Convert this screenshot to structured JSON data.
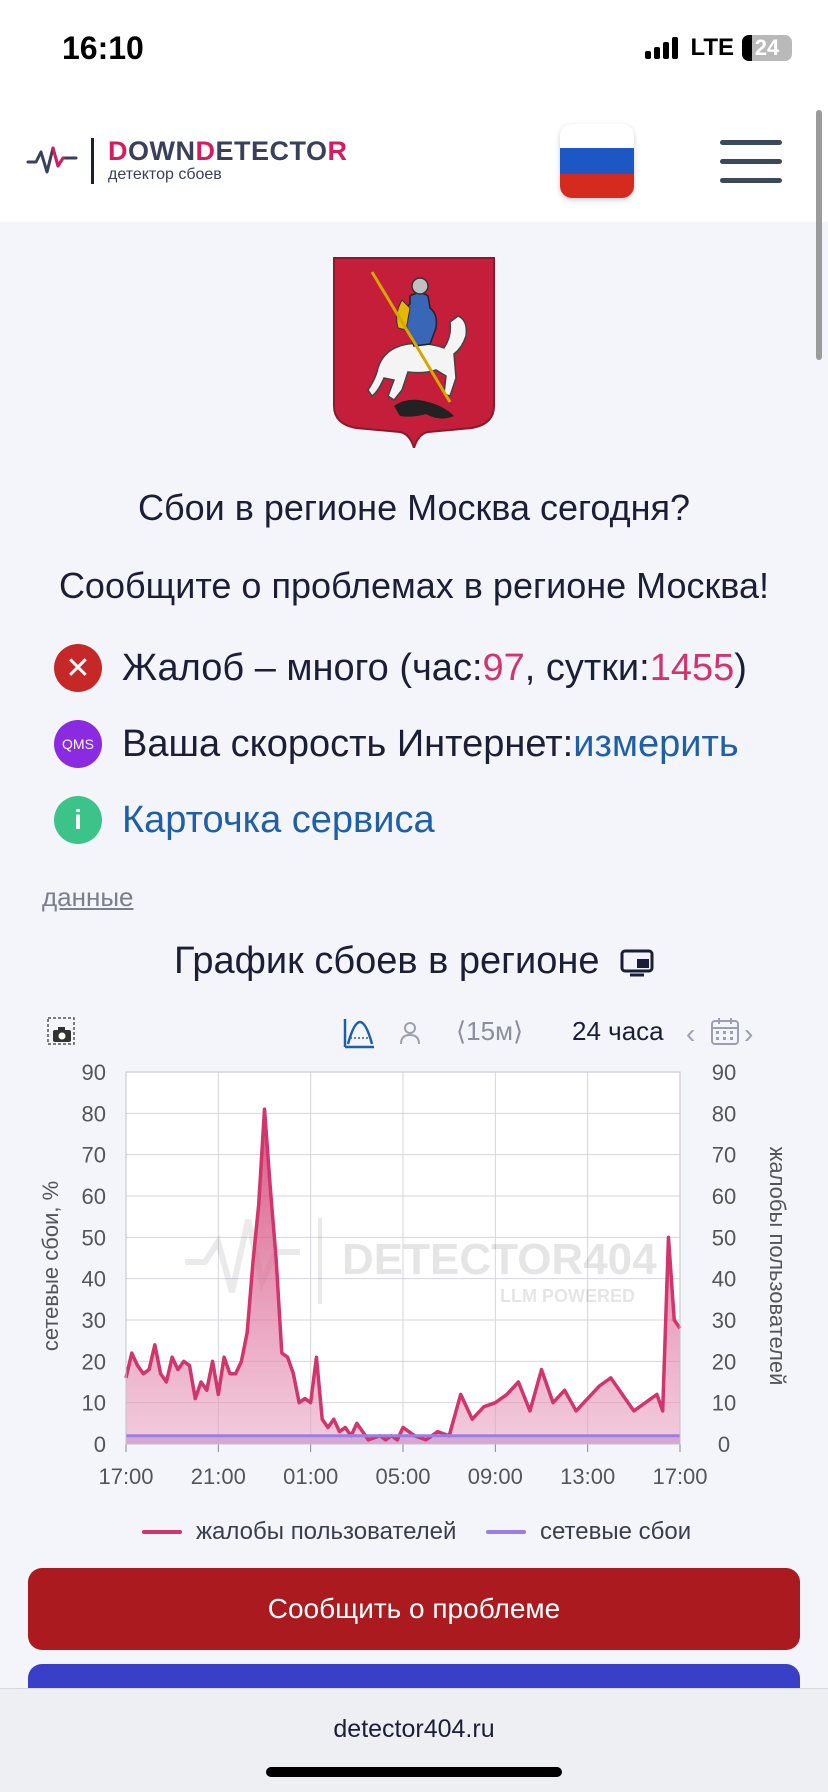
{
  "status": {
    "time": "16:10",
    "network": "LTE",
    "battery": "24"
  },
  "header": {
    "logo_title_parts": [
      "D",
      "OWN",
      "D",
      "ETECTO",
      "R"
    ],
    "logo_subtitle": "детектор сбоев"
  },
  "region": {
    "title": "Сбои в регионе Москва сегодня?",
    "subtitle": "Сообщите о проблемах в регионе Москва!"
  },
  "info": {
    "complaints_prefix": "Жалоб – много (час: ",
    "hour_count": "97",
    "mid": ", сутки: ",
    "day_count": "1455",
    "suffix": ")",
    "speed_label": "Ваша скорость Интернет: ",
    "speed_link": "измерить",
    "card_link": "Карточка сервиса",
    "qms_label": "QMS",
    "info_icon": "i",
    "error_icon": "✕"
  },
  "data_link": "данные",
  "chart_section": {
    "title": "График сбоев в регионе",
    "interval": "⟨15м⟩",
    "range": "24 часа",
    "prev": "‹",
    "next": "›"
  },
  "chart_data": {
    "type": "area",
    "y_left_label": "сетевые сбои, %",
    "y_right_label": "жалобы пользователей",
    "ylim": [
      0,
      90
    ],
    "y_ticks": [
      "0",
      "10",
      "20",
      "30",
      "40",
      "50",
      "60",
      "70",
      "80",
      "90"
    ],
    "x_ticks": [
      "17:00",
      "21:00",
      "01:00",
      "05:00",
      "09:00",
      "13:00",
      "17:00"
    ],
    "watermark": "DETECTOR404",
    "watermark_sub": "LLM POWERED",
    "x_hours": [
      0,
      0.25,
      0.5,
      0.75,
      1.0,
      1.25,
      1.5,
      1.75,
      2.0,
      2.25,
      2.5,
      2.75,
      3.0,
      3.25,
      3.5,
      3.75,
      4.0,
      4.25,
      4.5,
      4.75,
      5.0,
      5.25,
      5.5,
      5.75,
      6.0,
      6.25,
      6.5,
      6.75,
      7.0,
      7.25,
      7.5,
      7.75,
      8.0,
      8.25,
      8.5,
      8.75,
      9.0,
      9.25,
      9.5,
      9.75,
      10.0,
      10.5,
      11.0,
      11.25,
      11.5,
      11.75,
      12.0,
      12.5,
      13.0,
      13.5,
      14.0,
      14.5,
      15.0,
      15.5,
      16.0,
      16.5,
      17.0,
      17.5,
      18.0,
      18.5,
      19.0,
      19.5,
      20.0,
      20.5,
      21.0,
      21.5,
      22.0,
      22.5,
      23.0,
      23.25,
      23.5,
      23.75,
      24.0
    ],
    "series": [
      {
        "name": "жалобы пользователей",
        "color": "#d1356b",
        "values": [
          16,
          22,
          19,
          17,
          18,
          24,
          17,
          15,
          21,
          18,
          20,
          19,
          11,
          15,
          13,
          20,
          12,
          21,
          17,
          17,
          20,
          27,
          44,
          58,
          81,
          62,
          45,
          22,
          21,
          17,
          10,
          11,
          10,
          21,
          6,
          4,
          6,
          3,
          4,
          2,
          5,
          1,
          2,
          1,
          2,
          1,
          4,
          2,
          1,
          3,
          2,
          12,
          6,
          9,
          10,
          12,
          15,
          8,
          18,
          10,
          13,
          8,
          11,
          14,
          16,
          12,
          8,
          10,
          12,
          8,
          50,
          30,
          28
        ]
      },
      {
        "name": "сетевые сбои",
        "color": "#9b7fe0",
        "values": [
          2,
          2,
          2,
          2,
          2,
          2,
          2,
          2,
          2,
          2,
          2,
          2,
          2,
          2,
          2,
          2,
          2,
          2,
          2,
          2,
          2,
          2,
          2,
          2,
          2,
          2,
          2,
          2,
          2,
          2,
          2,
          2,
          2,
          2,
          2,
          2,
          2,
          2,
          2,
          2,
          2,
          2,
          2,
          2,
          2,
          2,
          2,
          2,
          2,
          2,
          2,
          2,
          2,
          2,
          2,
          2,
          2,
          2,
          2,
          2,
          2,
          2,
          2,
          2,
          2,
          2,
          2,
          2,
          2,
          2,
          2,
          2,
          2
        ]
      }
    ]
  },
  "legend": {
    "complaints": "жалобы пользователей",
    "outages": "сетевые сбои"
  },
  "actions": {
    "report": "Сообщить о проблеме"
  },
  "browser": {
    "url": "detector404.ru"
  }
}
